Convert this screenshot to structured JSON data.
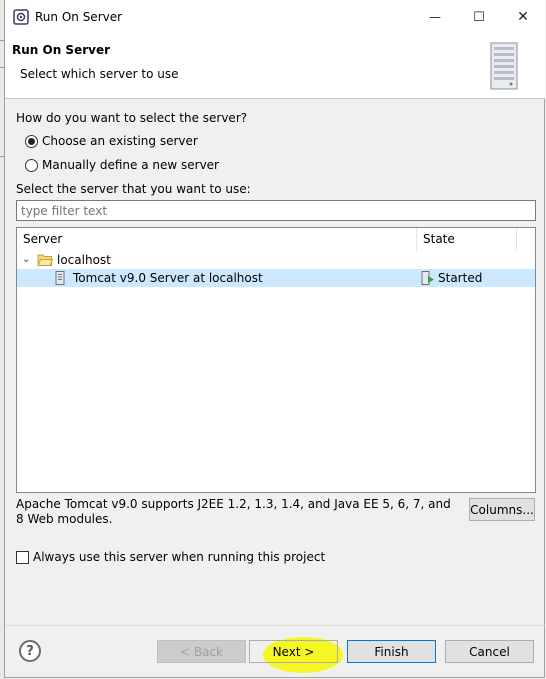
{
  "window": {
    "title": "Run On Server",
    "minimize_glyph": "—",
    "maximize_glyph": "☐",
    "close_glyph": "✕"
  },
  "header": {
    "title": "Run On Server",
    "subtitle": "Select which server to use"
  },
  "selection": {
    "question": "How do you want to select the server?",
    "option_existing": "Choose an existing server",
    "option_manual": "Manually define a new server",
    "selected": "existing"
  },
  "server_list": {
    "label": "Select the server that you want to use:",
    "filter_placeholder": "type filter text",
    "columns": [
      "Server",
      "State"
    ],
    "group": "localhost",
    "rows": [
      {
        "name": "Tomcat v9.0 Server at localhost",
        "state": "Started"
      }
    ]
  },
  "description": "Apache Tomcat v9.0 supports J2EE 1.2, 1.3, 1.4, and Java EE 5, 6, 7, and 8 Web modules.",
  "columns_button": "Columns...",
  "always_use_label": "Always use this server when running this project",
  "footer": {
    "help": "?",
    "back": "< Back",
    "next": "Next >",
    "finish": "Finish",
    "cancel": "Cancel"
  },
  "colors": {
    "selected_row": "#cce8ff",
    "highlight": "#f7f700",
    "default_button_border": "#0078d7"
  },
  "icons": {
    "app": "eclipse-server-icon",
    "folder": "folder-open-icon",
    "server": "server-icon",
    "started": "server-started-icon"
  }
}
